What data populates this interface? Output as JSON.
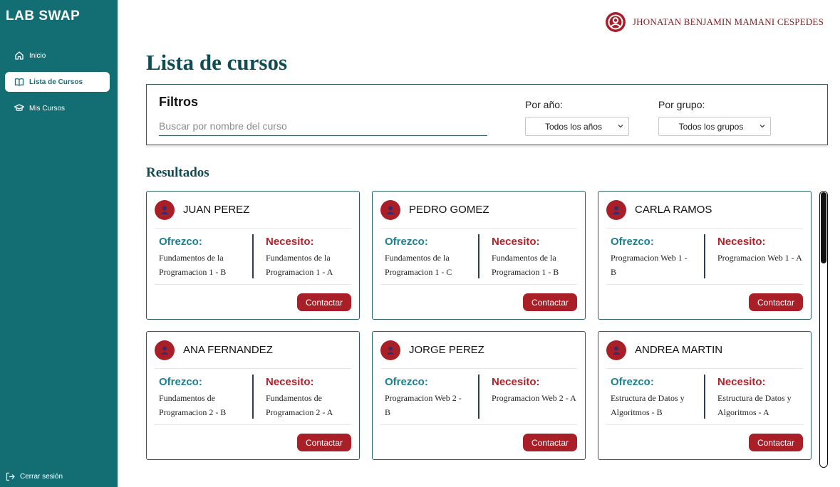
{
  "app": {
    "logo": "LAB SWAP"
  },
  "sidebar": {
    "items": [
      {
        "label": "Inicio",
        "icon": "home-icon"
      },
      {
        "label": "Lista de Cursos",
        "icon": "book-icon",
        "active": true
      },
      {
        "label": "Mis Cursos",
        "icon": "graduation-cap-icon"
      }
    ],
    "logout_label": "Cerrar sesión"
  },
  "header": {
    "user_name": "JHONATAN BENJAMIN MAMANI CESPEDES"
  },
  "main": {
    "title": "Lista de cursos",
    "results_title": "Resultados"
  },
  "filters": {
    "title": "Filtros",
    "search_placeholder": "Buscar por nombre del curso",
    "year_label": "Por año:",
    "year_value": "Todos los años",
    "group_label": "Por grupo:",
    "group_value": "Todos los grupos"
  },
  "labels": {
    "offer": "Ofrezco:",
    "need": "Necesito:",
    "contact": "Contactar"
  },
  "cards": [
    {
      "name": "JUAN PEREZ",
      "offer": "Fundamentos de la Programacion 1 - B",
      "need": "Fundamentos de la Programacion 1 - A"
    },
    {
      "name": "PEDRO GOMEZ",
      "offer": "Fundamentos de la Programacion 1 - C",
      "need": "Fundamentos de la Programacion 1 - B"
    },
    {
      "name": "CARLA RAMOS",
      "offer": "Programacion Web 1 - B",
      "need": "Programacion Web 1 - A"
    },
    {
      "name": "ANA FERNANDEZ",
      "offer": "Fundamentos de Programacion 2 - B",
      "need": "Fundamentos de Programacion 2 - A"
    },
    {
      "name": "JORGE PEREZ",
      "offer": "Programacion Web 2 - B",
      "need": "Programacion Web 2 - A"
    },
    {
      "name": "ANDREA MARTIN",
      "offer": "Estructura de Datos y Algoritmos - B",
      "need": "Estructura de Datos y Algoritmos - A"
    }
  ],
  "colors": {
    "sidebar": "#136e74",
    "accent_red": "#a91f28",
    "offer_teal": "#1a7f91",
    "title": "#0f4d52"
  }
}
